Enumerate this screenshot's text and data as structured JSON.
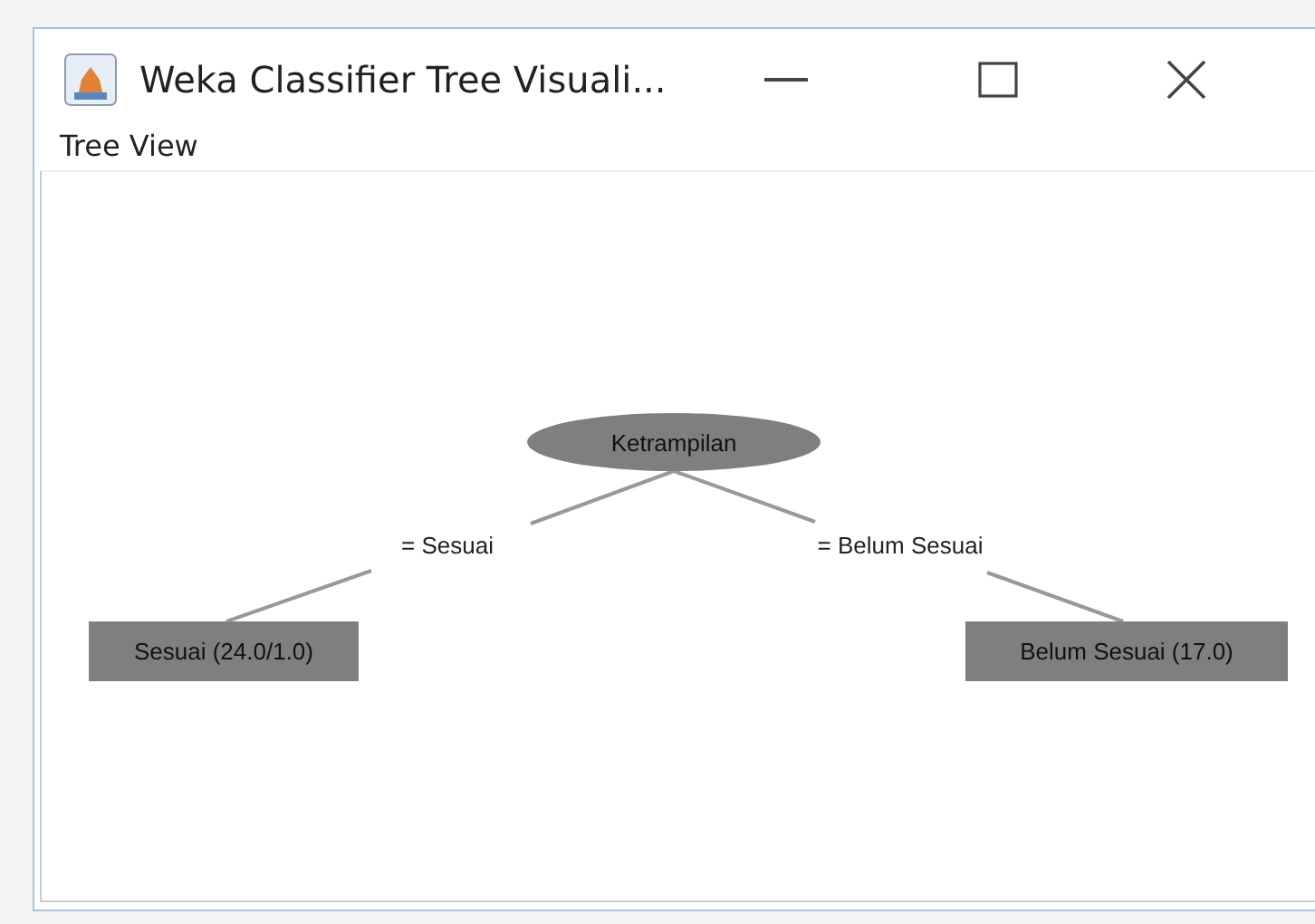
{
  "window": {
    "title": "Weka Classifier Tree Visuali..."
  },
  "panel": {
    "title": "Tree View"
  },
  "tree": {
    "kind": "split",
    "label": "Ketrampilan",
    "children": [
      {
        "edge": "= Sesuai",
        "node": {
          "kind": "leaf",
          "label": "Sesuai (24.0/1.0)"
        }
      },
      {
        "edge": "= Belum Sesuai",
        "node": {
          "kind": "leaf",
          "label": "Belum Sesuai (17.0)"
        }
      }
    ]
  }
}
